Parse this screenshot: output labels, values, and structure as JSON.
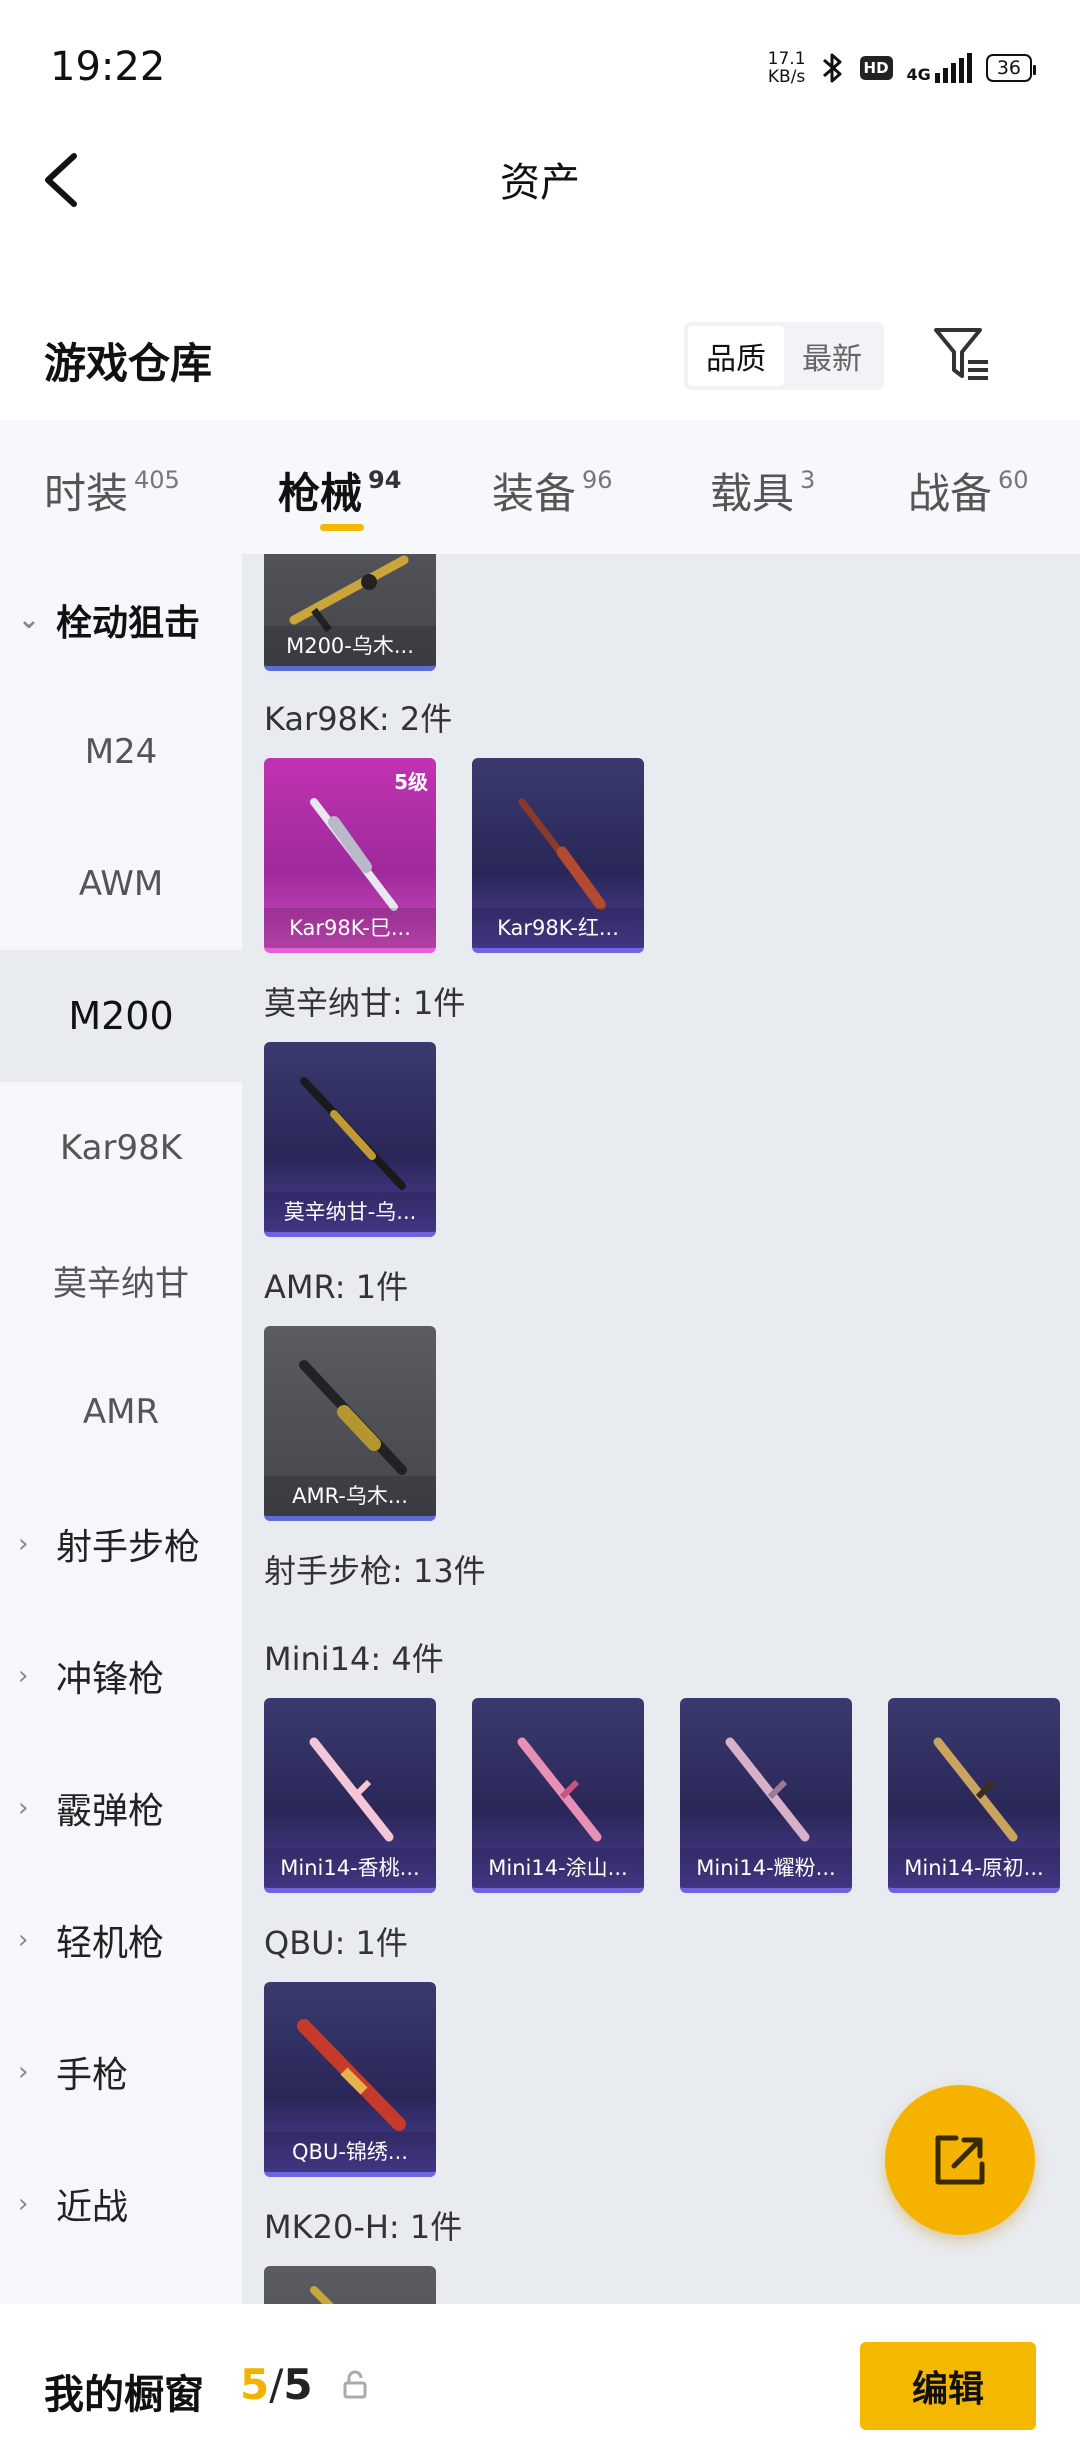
{
  "status_bar": {
    "time": "19:22",
    "net_speed_value": "17.1",
    "net_speed_unit": "KB/s",
    "hd": "HD",
    "network": "4G",
    "battery": "36"
  },
  "header": {
    "title": "资产",
    "back_icon": "chevron-left-icon"
  },
  "warehouse": {
    "title": "游戏仓库",
    "sort_options": [
      "品质",
      "最新"
    ],
    "sort_selected": "品质",
    "filter_icon": "filter-icon"
  },
  "tabs": [
    {
      "label": "时装",
      "count": "405"
    },
    {
      "label": "枪械",
      "count": "94",
      "active": true
    },
    {
      "label": "装备",
      "count": "96"
    },
    {
      "label": "载具",
      "count": "3"
    },
    {
      "label": "战备",
      "count": "60"
    }
  ],
  "sidebar": {
    "group_open": {
      "label": "栓动狙击"
    },
    "sub_items": [
      "M24",
      "AWM",
      "M200",
      "Kar98K",
      "莫辛纳甘",
      "AMR"
    ],
    "active_item": "M200",
    "groups": [
      "射手步枪",
      "冲锋枪",
      "霰弹枪",
      "轻机枪",
      "手枪",
      "近战"
    ]
  },
  "content": {
    "top_card": {
      "caption": "M200-乌木..."
    },
    "sections": [
      {
        "heading": "Kar98K: 2件",
        "cards": [
          {
            "caption": "Kar98K-巳...",
            "level": "5级",
            "style": "pink"
          },
          {
            "caption": "Kar98K-红...",
            "style": "purple"
          }
        ]
      },
      {
        "heading": "莫辛纳甘: 1件",
        "cards": [
          {
            "caption": "莫辛纳甘-乌...",
            "style": "purple"
          }
        ]
      },
      {
        "heading": "AMR: 1件",
        "cards": [
          {
            "caption": "AMR-乌木...",
            "style": "grey"
          }
        ]
      },
      {
        "heading": "射手步枪: 13件"
      },
      {
        "heading": "Mini14: 4件",
        "cards": [
          {
            "caption": "Mini14-香桃...",
            "style": "purple"
          },
          {
            "caption": "Mini14-涂山...",
            "style": "purple"
          },
          {
            "caption": "Mini14-耀粉...",
            "style": "purple"
          },
          {
            "caption": "Mini14-原初...",
            "style": "purple"
          }
        ]
      },
      {
        "heading": "QBU: 1件",
        "cards": [
          {
            "caption": "QBU-锦绣...",
            "style": "purple"
          }
        ]
      },
      {
        "heading": "MK20-H: 1件"
      }
    ]
  },
  "fab": {
    "icon": "share-external-icon"
  },
  "bottom_bar": {
    "title": "我的橱窗",
    "count_current": "5",
    "count_sep": "/",
    "count_total": "5",
    "lock_icon": "lock-icon",
    "edit_label": "编辑"
  },
  "colors": {
    "accent": "#f5b800",
    "tab_indicator": "#f5b800"
  }
}
